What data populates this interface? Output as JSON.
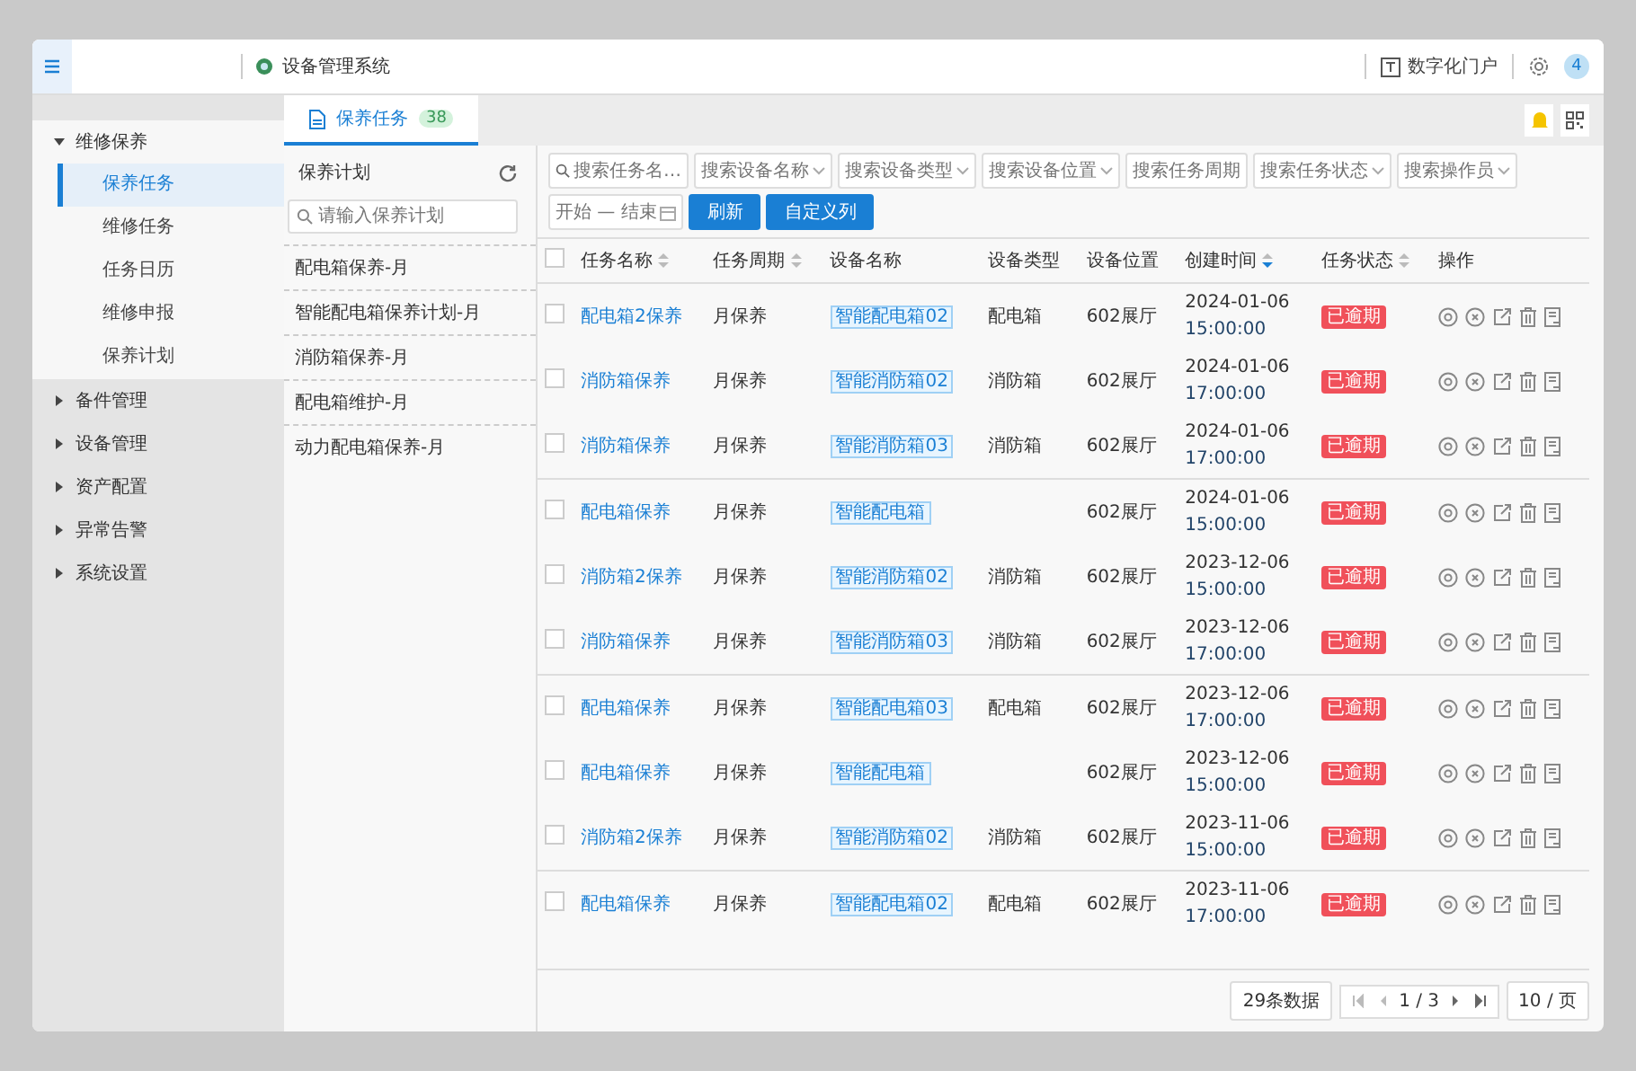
{
  "header": {
    "app_title": "设备管理系统",
    "portal_link": "数字化门户",
    "avatar": "4"
  },
  "sidebar": {
    "items": [
      {
        "label": "维修保养",
        "expanded": true,
        "children": [
          {
            "label": "保养任务",
            "selected": true
          },
          {
            "label": "维修任务",
            "selected": false
          },
          {
            "label": "任务日历",
            "selected": false
          },
          {
            "label": "维修申报",
            "selected": false
          },
          {
            "label": "保养计划",
            "selected": false
          }
        ]
      },
      {
        "label": "备件管理",
        "expanded": false
      },
      {
        "label": "设备管理",
        "expanded": false
      },
      {
        "label": "资产配置",
        "expanded": false
      },
      {
        "label": "异常告警",
        "expanded": false
      },
      {
        "label": "系统设置",
        "expanded": false
      }
    ]
  },
  "tabs": [
    {
      "label": "保养任务",
      "badge": "38",
      "selected": true
    }
  ],
  "plan_panel": {
    "title": "保养计划",
    "search": {
      "placeholder": "请输入保养计划"
    },
    "items": [
      "配电箱保养-月",
      "智能配电箱保养计划-月",
      "消防箱保养-月",
      "配电箱维护-月",
      "动力配电箱保养-月"
    ]
  },
  "filters": [
    {
      "placeholder": "搜索任务名…",
      "kind": "text"
    },
    {
      "placeholder": "搜索设备名称",
      "kind": "select"
    },
    {
      "placeholder": "搜索设备类型",
      "kind": "select"
    },
    {
      "placeholder": "搜索设备位置",
      "kind": "select"
    },
    {
      "placeholder": "搜索任务周期",
      "kind": "text"
    },
    {
      "placeholder": "搜索任务状态",
      "kind": "select"
    },
    {
      "placeholder": "搜索操作员",
      "kind": "select"
    },
    {
      "placeholder": "开始 — 结束",
      "kind": "date"
    }
  ],
  "buttons": [
    "刷新",
    "自定义列"
  ],
  "table": {
    "columns": [
      {
        "label": "任务名称",
        "sortable": true,
        "sort_active": false
      },
      {
        "label": "任务周期",
        "sortable": true,
        "sort_active": false
      },
      {
        "label": "设备名称"
      },
      {
        "label": "设备类型"
      },
      {
        "label": "设备位置"
      },
      {
        "label": "创建时间",
        "sortable": true,
        "sort_active": true
      },
      {
        "label": "任务状态",
        "sortable": true,
        "sort_active": false
      },
      {
        "label": "操作"
      }
    ],
    "header_checked": false,
    "rows": [
      {
        "checked": false,
        "name": "配电箱2保养",
        "cycle": "月保养",
        "device": "智能配电箱02",
        "type": "配电箱",
        "location": "602展厅",
        "date": "2024-01-06",
        "time": "15:00:00",
        "status": "已逾期"
      },
      {
        "checked": false,
        "name": "消防箱保养",
        "cycle": "月保养",
        "device": "智能消防箱02",
        "type": "消防箱",
        "location": "602展厅",
        "date": "2024-01-06",
        "time": "17:00:00",
        "status": "已逾期"
      },
      {
        "checked": false,
        "name": "消防箱保养",
        "cycle": "月保养",
        "device": "智能消防箱03",
        "type": "消防箱",
        "location": "602展厅",
        "date": "2024-01-06",
        "time": "17:00:00",
        "status": "已逾期"
      },
      {
        "checked": false,
        "name": "配电箱保养",
        "cycle": "月保养",
        "device": "智能配电箱",
        "type": "",
        "location": "602展厅",
        "date": "2024-01-06",
        "time": "15:00:00",
        "status": "已逾期"
      },
      {
        "checked": false,
        "name": "消防箱2保养",
        "cycle": "月保养",
        "device": "智能消防箱02",
        "type": "消防箱",
        "location": "602展厅",
        "date": "2023-12-06",
        "time": "15:00:00",
        "status": "已逾期"
      },
      {
        "checked": false,
        "name": "消防箱保养",
        "cycle": "月保养",
        "device": "智能消防箱03",
        "type": "消防箱",
        "location": "602展厅",
        "date": "2023-12-06",
        "time": "17:00:00",
        "status": "已逾期"
      },
      {
        "checked": false,
        "name": "配电箱保养",
        "cycle": "月保养",
        "device": "智能配电箱03",
        "type": "配电箱",
        "location": "602展厅",
        "date": "2023-12-06",
        "time": "17:00:00",
        "status": "已逾期"
      },
      {
        "checked": false,
        "name": "配电箱保养",
        "cycle": "月保养",
        "device": "智能配电箱",
        "type": "",
        "location": "602展厅",
        "date": "2023-12-06",
        "time": "15:00:00",
        "status": "已逾期"
      },
      {
        "checked": false,
        "name": "消防箱2保养",
        "cycle": "月保养",
        "device": "智能消防箱02",
        "type": "消防箱",
        "location": "602展厅",
        "date": "2023-11-06",
        "time": "15:00:00",
        "status": "已逾期"
      },
      {
        "checked": false,
        "name": "配电箱保养",
        "cycle": "月保养",
        "device": "智能配电箱02",
        "type": "配电箱",
        "location": "602展厅",
        "date": "2023-11-06",
        "time": "17:00:00",
        "status": "已逾期"
      }
    ]
  },
  "pagination": {
    "total": "29条数据",
    "page": "1 / 3",
    "page_size": "10 / 页"
  }
}
